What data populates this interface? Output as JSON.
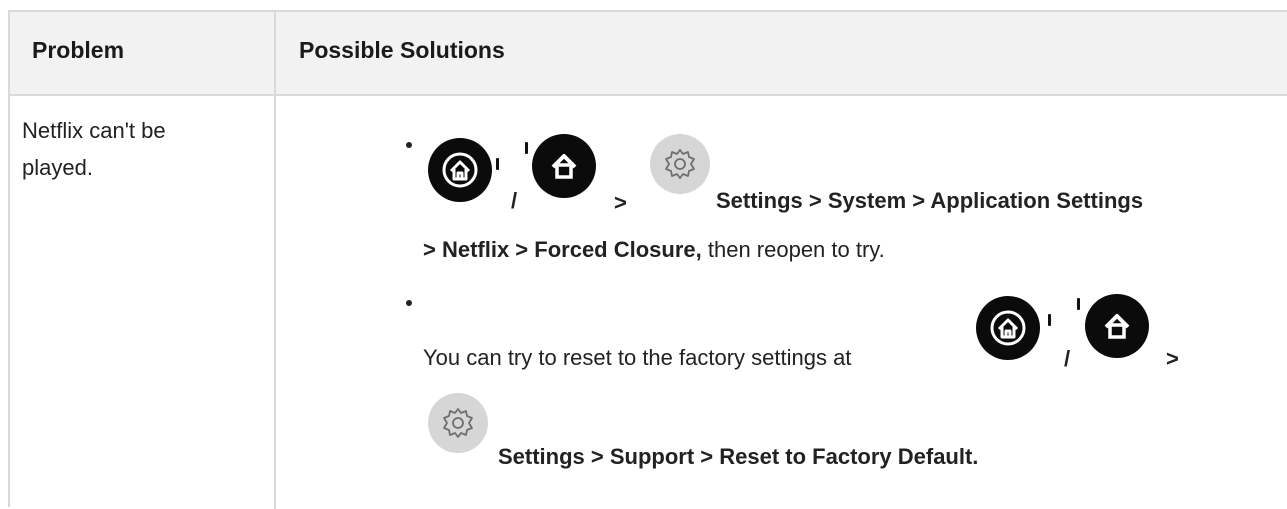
{
  "table": {
    "headers": {
      "problem": "Problem",
      "solutions": "Possible Solutions"
    },
    "rows": [
      {
        "problem": "Netflix can't be played.",
        "solutions": [
          {
            "separator": "/",
            "arrow": ">",
            "path_bold": "Settings > System > Application Settings",
            "path_bold_2": "> Netflix > Forced Closure,",
            "suffix": " then reopen to try."
          },
          {
            "prefix": "You can try to reset to the factory settings at",
            "separator": "/",
            "arrow": ">",
            "path_bold": "Settings > Support > Reset to Factory Default."
          }
        ]
      }
    ]
  },
  "icons": {
    "home": "home-icon",
    "settings": "gear-icon"
  },
  "colors": {
    "header_bg": "#f2f2f2",
    "border": "#d9d9d9",
    "icon_dark": "#0b0b0b",
    "gear_bg": "#d6d6d6"
  }
}
